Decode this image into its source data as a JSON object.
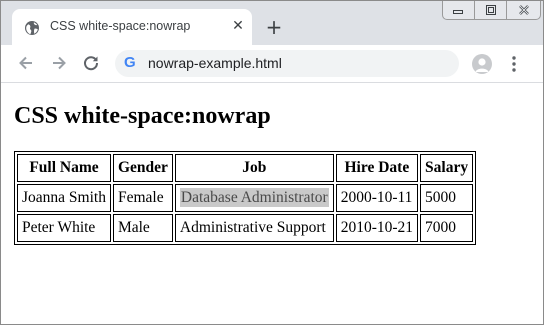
{
  "browser": {
    "tab": {
      "title": "CSS white-space:nowrap",
      "favicon": "globe-icon",
      "close_glyph": "✕"
    },
    "new_tab_glyph": "+",
    "address": {
      "url": "nowrap-example.html",
      "site_icon_letter": "G"
    }
  },
  "page": {
    "heading": "CSS white-space:nowrap",
    "table": {
      "headers": [
        "Full Name",
        "Gender",
        "Job",
        "Hire Date",
        "Salary"
      ],
      "rows": [
        [
          "Joanna Smith",
          "Female",
          "Database Administrator",
          "2000-10-11",
          "5000"
        ],
        [
          "Peter White",
          "Male",
          "Administrative Support",
          "2010-10-21",
          "7000"
        ]
      ],
      "highlighted_cell": {
        "row": 0,
        "col": 2
      }
    }
  },
  "colors": {
    "tabstrip": "#dee1e6",
    "omnibox": "#f1f3f4",
    "highlight": "#c9c9c9",
    "icon": "#5f6368"
  }
}
